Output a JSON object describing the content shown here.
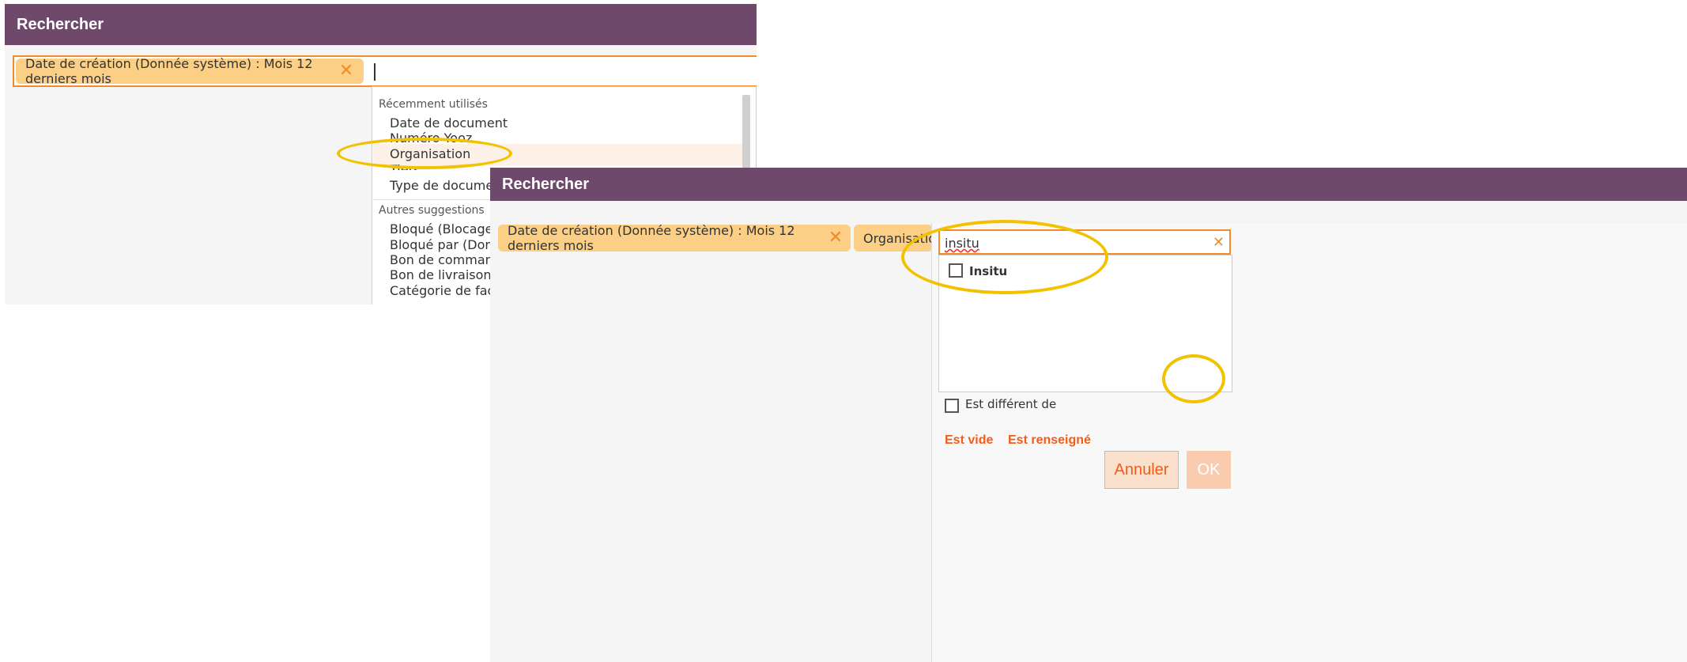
{
  "colors": {
    "header": "#6e496b",
    "accent": "#f28c28",
    "chip": "#fbcf85",
    "highlight": "#f2c200",
    "link": "#f25c1a"
  },
  "panel1": {
    "title": "Rechercher",
    "chip_label": "Date de création (Donnée système) : Mois 12 derniers mois",
    "dropdown": {
      "section_recent": "Récemment utilisés",
      "recent_items": [
        "Date de document",
        "Numéro Yooz",
        "Organisation",
        "Tiers",
        "Type de document"
      ],
      "section_other": "Autres suggestions",
      "other_items": [
        "Bloqué (Blocage)",
        "Bloqué par (Donnée",
        "Bon de commande (",
        "Bon de livraison (Aut",
        "Catégorie de facture"
      ]
    }
  },
  "panel2": {
    "title": "Rechercher",
    "chip_label": "Date de création (Donnée système) : Mois 12 derniers mois",
    "chip2_label": "Organisation:",
    "search_value": "insitu",
    "result_item": "Insitu",
    "option_not_equal": "Est différent de",
    "link_empty": "Est vide",
    "link_filled": "Est renseigné",
    "cancel_label": "Annuler",
    "ok_label": "OK"
  },
  "icons": {
    "close": "close-icon",
    "checkbox": "checkbox-icon"
  }
}
